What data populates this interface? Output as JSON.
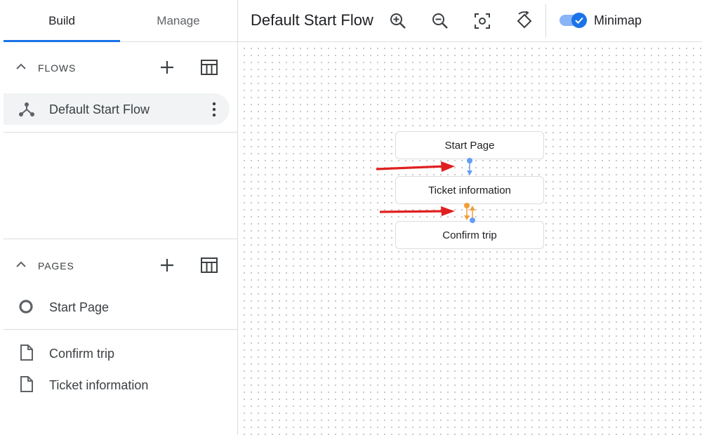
{
  "tabs": {
    "build": "Build",
    "manage": "Manage"
  },
  "flows": {
    "title": "FLOWS",
    "items": [
      {
        "label": "Default Start Flow"
      }
    ]
  },
  "pages": {
    "title": "PAGES",
    "start": "Start Page",
    "items": [
      {
        "label": "Confirm trip"
      },
      {
        "label": "Ticket information"
      }
    ]
  },
  "toolbar": {
    "flow_title": "Default Start Flow",
    "minimap_label": "Minimap",
    "minimap_on": true
  },
  "canvas": {
    "nodes": [
      "Start Page",
      "Ticket information",
      "Confirm trip"
    ]
  },
  "colors": {
    "accent": "#1a73e8",
    "route_orange": "#f29d38",
    "route_blue": "#669df6",
    "annotation_red": "#e02020"
  },
  "icons": [
    "chevron-up-icon",
    "add-icon",
    "table-icon",
    "flow-icon",
    "more-vert-icon",
    "start-page-icon",
    "page-icon",
    "zoom-in-icon",
    "zoom-out-icon",
    "center-focus-icon",
    "auto-layout-icon",
    "check-icon"
  ]
}
